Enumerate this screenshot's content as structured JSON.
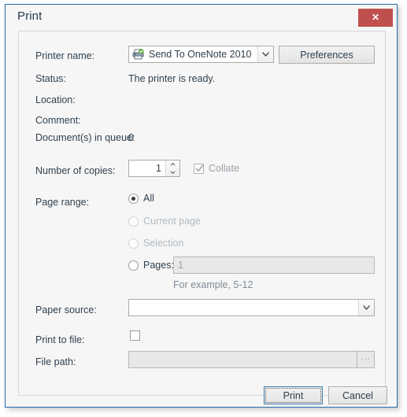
{
  "window": {
    "title": "Print",
    "close_label": "✕",
    "close_icon": "close-icon",
    "accent_border": "#2a6ba8",
    "close_bg": "#c0504d",
    "panel_bg": "#f6f6f6"
  },
  "printer": {
    "name_label": "Printer name:",
    "selected": "Send To OneNote 2010",
    "icon": "printer-icon",
    "preferences_label": "Preferences",
    "status_label": "Status:",
    "status_value": "The printer is ready.",
    "location_label": "Location:",
    "location_value": "",
    "comment_label": "Comment:",
    "comment_value": "",
    "queue_label": "Document(s) in queue:",
    "queue_value": "0"
  },
  "copies": {
    "label": "Number of copies:",
    "value": "1",
    "collate_label": "Collate",
    "collate_checked": true,
    "collate_enabled": false
  },
  "page_range": {
    "label": "Page range:",
    "options": [
      {
        "label": "All",
        "selected": true,
        "enabled": true
      },
      {
        "label": "Current page",
        "selected": false,
        "enabled": false
      },
      {
        "label": "Selection",
        "selected": false,
        "enabled": false
      },
      {
        "label": "Pages:",
        "selected": false,
        "enabled": true
      }
    ],
    "pages_value": "1",
    "pages_enabled": false,
    "example_hint": "For example, 5-12"
  },
  "paper_source": {
    "label": "Paper source:",
    "value": ""
  },
  "print_to_file": {
    "label": "Print to file:",
    "checked": false,
    "path_label": "File path:",
    "path_value": "",
    "path_enabled": false,
    "browse_label": "..."
  },
  "footer": {
    "print_label": "Print",
    "cancel_label": "Cancel",
    "print_focused": true
  }
}
